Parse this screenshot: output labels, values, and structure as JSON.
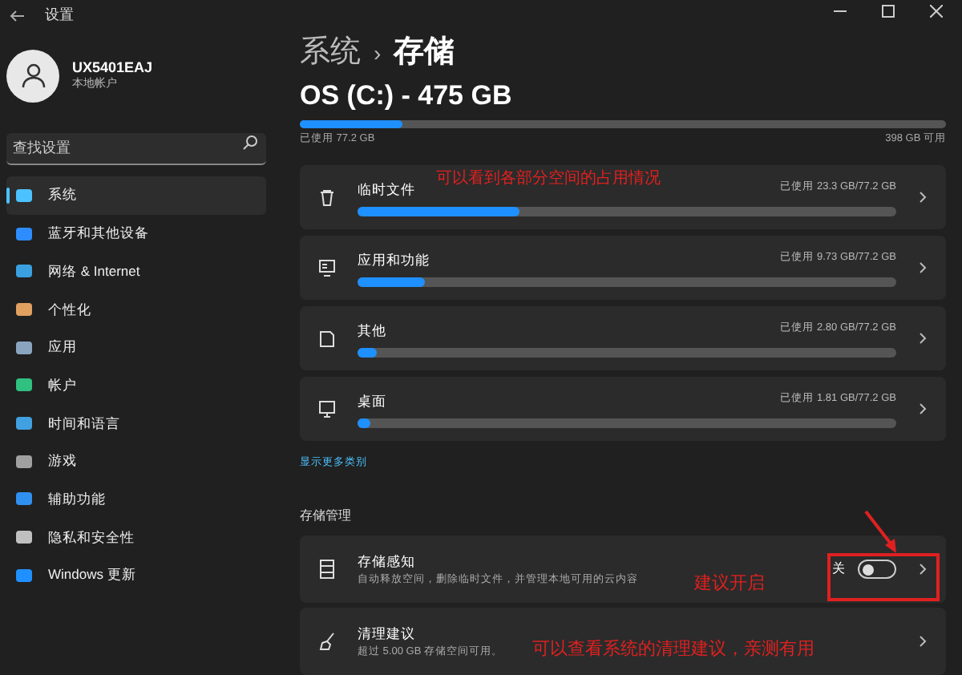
{
  "window": {
    "title": "设置"
  },
  "account": {
    "name": "UX5401EAJ",
    "type": "本地帐户"
  },
  "search": {
    "placeholder": "查找设置"
  },
  "sidebar": {
    "items": [
      {
        "label": "系统",
        "selected": true,
        "color": "#4cc2ff"
      },
      {
        "label": "蓝牙和其他设备",
        "selected": false,
        "color": "#2d8cff"
      },
      {
        "label": "网络 & Internet",
        "selected": false,
        "color": "#3aa0e0"
      },
      {
        "label": "个性化",
        "selected": false,
        "color": "#e0a060"
      },
      {
        "label": "应用",
        "selected": false,
        "color": "#8aa4c0"
      },
      {
        "label": "帐户",
        "selected": false,
        "color": "#30c080"
      },
      {
        "label": "时间和语言",
        "selected": false,
        "color": "#40a0e0"
      },
      {
        "label": "游戏",
        "selected": false,
        "color": "#a0a0a0"
      },
      {
        "label": "辅助功能",
        "selected": false,
        "color": "#3090f0"
      },
      {
        "label": "隐私和安全性",
        "selected": false,
        "color": "#c0c0c0"
      },
      {
        "label": "Windows 更新",
        "selected": false,
        "color": "#1e90ff"
      }
    ]
  },
  "breadcrumb": {
    "parent": "系统",
    "separator": "›",
    "current": "存储"
  },
  "drive": {
    "title": "OS (C:) - 475 GB",
    "level": 0.16,
    "used": "已使用 77.2 GB",
    "free": "398 GB 可用"
  },
  "categories": [
    {
      "kind": "trash",
      "name": "临时文件",
      "usage": "已使用 23.3 GB/77.2 GB",
      "level": 0.3
    },
    {
      "kind": "apps",
      "name": "应用和功能",
      "usage": "已使用 9.73 GB/77.2 GB",
      "level": 0.125
    },
    {
      "kind": "other",
      "name": "其他",
      "usage": "已使用 2.80 GB/77.2 GB",
      "level": 0.037
    },
    {
      "kind": "desktop",
      "name": "桌面",
      "usage": "已使用 1.81 GB/77.2 GB",
      "level": 0.024
    }
  ],
  "show_more": "显示更多类别",
  "management": {
    "heading": "存储管理",
    "items": [
      {
        "kind": "toggle",
        "name": "存储感知",
        "description": "自动释放空间，删除临时文件，并管理本地可用的云内容",
        "state_label": "关",
        "on": false
      },
      {
        "kind": "link",
        "name": "清理建议",
        "description": "超过 5.00 GB 存储空间可用。"
      }
    ]
  },
  "annotations": [
    "可以看到各部分空间的占用情况",
    "建议开启",
    "可以查看系统的清理建议，亲测有用"
  ]
}
